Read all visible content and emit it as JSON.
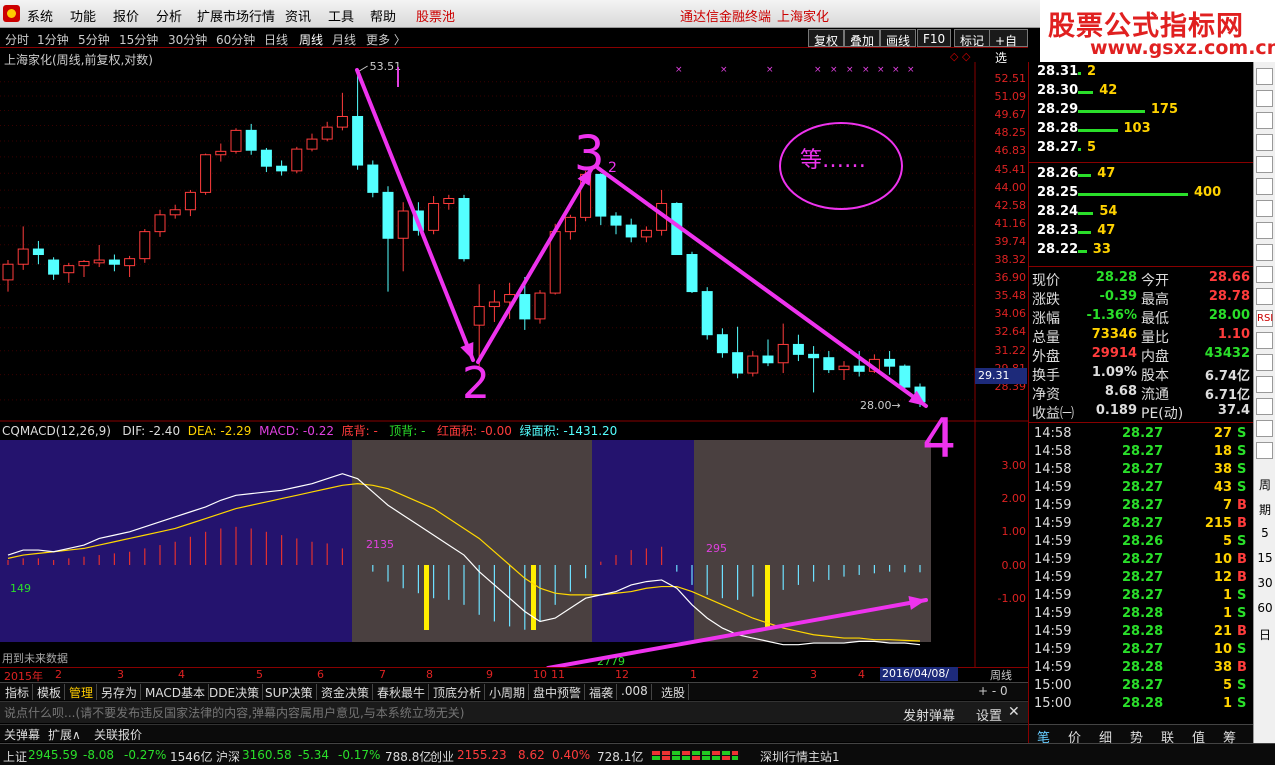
{
  "menu": {
    "items": [
      "系统",
      "功能",
      "报价",
      "分析",
      "扩展市场行情",
      "资讯",
      "工具",
      "帮助"
    ],
    "stock_pool": "股票池",
    "brand": "通达信金融终端",
    "stock_name": "上海家化"
  },
  "banner": {
    "title": "股票公式指标网",
    "url": "www.gsxz.com.cn"
  },
  "periods": [
    "分时",
    "1分钟",
    "5分钟",
    "15分钟",
    "30分钟",
    "60分钟",
    "日线",
    "周线",
    "月线",
    "更多 〉"
  ],
  "active_period": "周线",
  "toolbar_buttons": [
    "复权",
    "叠加",
    "画线",
    "F10",
    "标记",
    "+自选"
  ],
  "chart": {
    "title": "上海家化(周线,前复权,对数)",
    "diamonds": "◇ ◇",
    "high_label": "53.51",
    "low_label": "28.00",
    "price_ticks": [
      "52.51",
      "51.09",
      "49.67",
      "48.25",
      "46.83",
      "45.41",
      "44.00",
      "42.58",
      "41.16",
      "39.74",
      "38.32",
      "36.90",
      "35.48",
      "34.06",
      "32.64",
      "31.22",
      "29.81",
      "28.39"
    ],
    "current_price_tag": "29.31",
    "annotation_text": "等……",
    "handwritten": [
      "2",
      "3",
      "4",
      "2"
    ]
  },
  "indicator": {
    "name": "CQMACD(12,26,9)",
    "dif": "DIF: -2.40",
    "dea": "DEA: -2.29",
    "macd": "MACD: -0.22",
    "bottom_div": "底背: -",
    "top_div": "顶背: -",
    "red_area": "红面积: -0.00",
    "green_area": "绿面积: -1431.20",
    "ticks": [
      "3.00",
      "2.00",
      "1.00",
      "0.00",
      "-1.00"
    ],
    "labels": {
      "a": "149",
      "b": "2135",
      "c": "295",
      "d": "2779"
    },
    "future_data": "用到未来数据"
  },
  "date_axis": {
    "ticks": [
      "2015年",
      "2",
      "3",
      "4",
      "5",
      "6",
      "7",
      "8",
      "9",
      "10",
      "11",
      "12",
      "1",
      "2",
      "3",
      "4"
    ],
    "selected": "2016/04/08/五",
    "period_label": "周线"
  },
  "tabs": [
    "指标",
    "模板",
    "管理",
    "另存为",
    "MACD基本",
    "DDE决策",
    "SUP决策",
    "资金决策",
    "春秋最牛",
    "顶底分析",
    "小周期",
    "盘中预警",
    "福袭",
    ".008",
    "选股"
  ],
  "active_tab": "管理",
  "zoom": "+ - 0",
  "comment": {
    "placeholder": "说点什么呗...(请不要发布违反国家法律的内容,弹幕内容属用户意见,与本系统立场无关)",
    "send": "发射弹幕",
    "settings": "设置",
    "close": "✕"
  },
  "danmu": {
    "close": "关弹幕",
    "expand": "扩展∧",
    "related": "关联报价"
  },
  "status": {
    "sh_label": "上证",
    "sh_val": "2945.59",
    "sh_chg": "-8.08",
    "sh_pct": "-0.27%",
    "sh_amt": "1546亿",
    "hs_label": "沪深",
    "hs_val": "3160.58",
    "hs_chg": "-5.34",
    "hs_pct": "-0.17%",
    "hs_amt": "788.8亿",
    "cy_label": "创业",
    "cy_val": "2155.23",
    "cy_chg": "8.62",
    "cy_pct": "0.40%",
    "cy_amt": "728.1亿",
    "server": "深圳行情主站1"
  },
  "orderbook": {
    "asks": [
      {
        "price": "28.31",
        "vol": "2",
        "bar": 0.01
      },
      {
        "price": "28.30",
        "vol": "42",
        "bar": 0.1
      },
      {
        "price": "28.29",
        "vol": "175",
        "bar": 0.44
      },
      {
        "price": "28.28",
        "vol": "103",
        "bar": 0.26
      },
      {
        "price": "28.27",
        "vol": "5",
        "bar": 0.01
      }
    ],
    "bids": [
      {
        "price": "28.26",
        "vol": "47",
        "bar": 0.12
      },
      {
        "price": "28.25",
        "vol": "400",
        "bar": 1.0
      },
      {
        "price": "28.24",
        "vol": "54",
        "bar": 0.14
      },
      {
        "price": "28.23",
        "vol": "47",
        "bar": 0.12
      },
      {
        "price": "28.22",
        "vol": "33",
        "bar": 0.08
      }
    ]
  },
  "quote": [
    {
      "l1": "现价",
      "v1": "28.28",
      "c1": "green",
      "l2": "今开",
      "v2": "28.66",
      "c2": "red"
    },
    {
      "l1": "涨跌",
      "v1": "-0.39",
      "c1": "green",
      "l2": "最高",
      "v2": "28.78",
      "c2": "red"
    },
    {
      "l1": "涨幅",
      "v1": "-1.36%",
      "c1": "green",
      "l2": "最低",
      "v2": "28.00",
      "c2": "green"
    },
    {
      "l1": "总量",
      "v1": "73346",
      "c1": "yel",
      "l2": "量比",
      "v2": "1.10",
      "c2": "red"
    },
    {
      "l1": "外盘",
      "v1": "29914",
      "c1": "red",
      "l2": "内盘",
      "v2": "43432",
      "c2": "green"
    },
    {
      "l1": "换手",
      "v1": "1.09%",
      "c1": "wht",
      "l2": "股本",
      "v2": "6.74亿",
      "c2": "wht"
    },
    {
      "l1": "净资",
      "v1": "8.68",
      "c1": "wht",
      "l2": "流通",
      "v2": "6.71亿",
      "c2": "wht"
    },
    {
      "l1": "收益㈠",
      "v1": "0.189",
      "c1": "wht",
      "l2": "PE(动)",
      "v2": "37.4",
      "c2": "wht"
    }
  ],
  "ticks": [
    {
      "t": "14:58",
      "p": "28.27",
      "v": "27",
      "d": "S"
    },
    {
      "t": "14:58",
      "p": "28.27",
      "v": "18",
      "d": "S"
    },
    {
      "t": "14:58",
      "p": "28.27",
      "v": "38",
      "d": "S"
    },
    {
      "t": "14:59",
      "p": "28.27",
      "v": "43",
      "d": "S"
    },
    {
      "t": "14:59",
      "p": "28.27",
      "v": "7",
      "d": "B"
    },
    {
      "t": "14:59",
      "p": "28.27",
      "v": "215",
      "d": "B"
    },
    {
      "t": "14:59",
      "p": "28.26",
      "v": "5",
      "d": "S"
    },
    {
      "t": "14:59",
      "p": "28.27",
      "v": "10",
      "d": "B"
    },
    {
      "t": "14:59",
      "p": "28.27",
      "v": "12",
      "d": "B"
    },
    {
      "t": "14:59",
      "p": "28.27",
      "v": "1",
      "d": "S"
    },
    {
      "t": "14:59",
      "p": "28.28",
      "v": "1",
      "d": "S"
    },
    {
      "t": "14:59",
      "p": "28.28",
      "v": "21",
      "d": "B"
    },
    {
      "t": "14:59",
      "p": "28.27",
      "v": "10",
      "d": "S"
    },
    {
      "t": "14:59",
      "p": "28.28",
      "v": "38",
      "d": "B"
    },
    {
      "t": "15:00",
      "p": "28.27",
      "v": "5",
      "d": "S"
    },
    {
      "t": "15:00",
      "p": "28.28",
      "v": "1",
      "d": "S"
    }
  ],
  "rp_tabs": [
    "笔",
    "价",
    "细",
    "势",
    "联",
    "值",
    "筹"
  ],
  "side_numbers": [
    "周",
    "期",
    "5",
    "15",
    "30",
    "60",
    "日"
  ],
  "colors": {
    "up": "#ff3c3c",
    "down": "#54ffff",
    "arrow": "#ee33ee",
    "dif": "#ffffff",
    "dea": "#ffd700"
  }
}
